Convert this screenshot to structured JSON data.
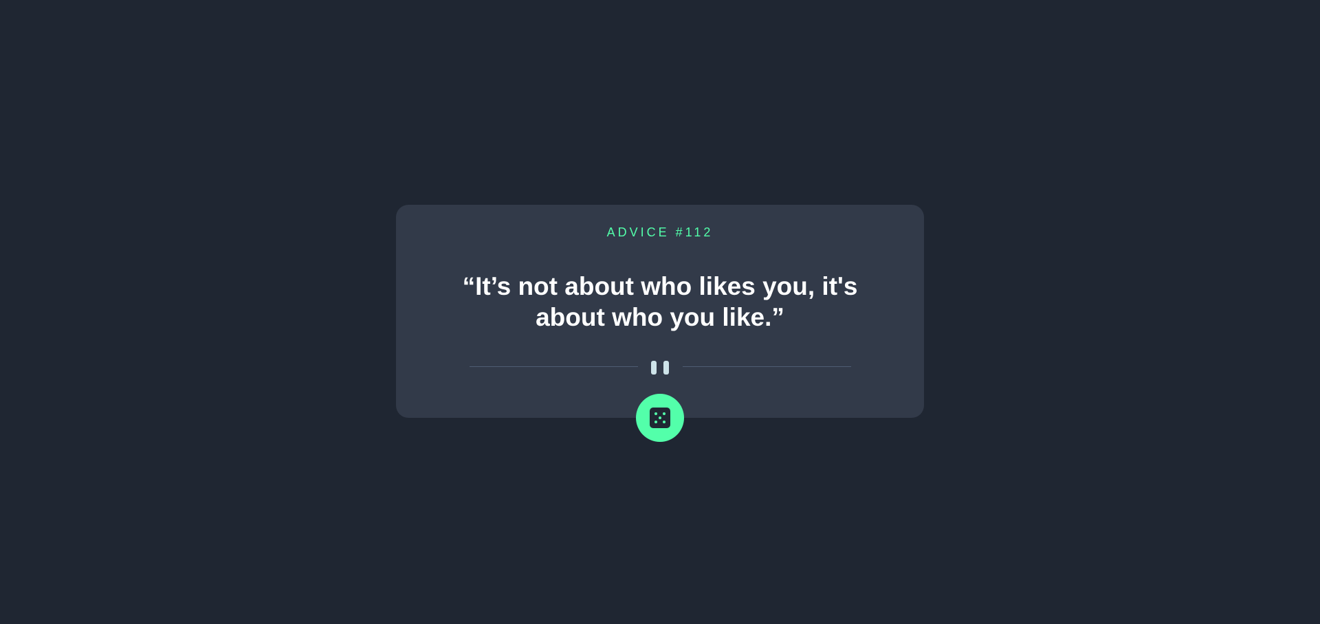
{
  "advice": {
    "id_label": "ADVICE #112",
    "quote": "“It’s not about who likes you, it's about who you like.”"
  },
  "icons": {
    "divider": "pause-icon",
    "button": "dice-icon"
  },
  "colors": {
    "background": "#1f2632",
    "card": "#323a49",
    "accent": "#53ffaa",
    "text": "#ffffff",
    "divider_line": "#4f5d74",
    "divider_icon": "#cee3e9"
  }
}
